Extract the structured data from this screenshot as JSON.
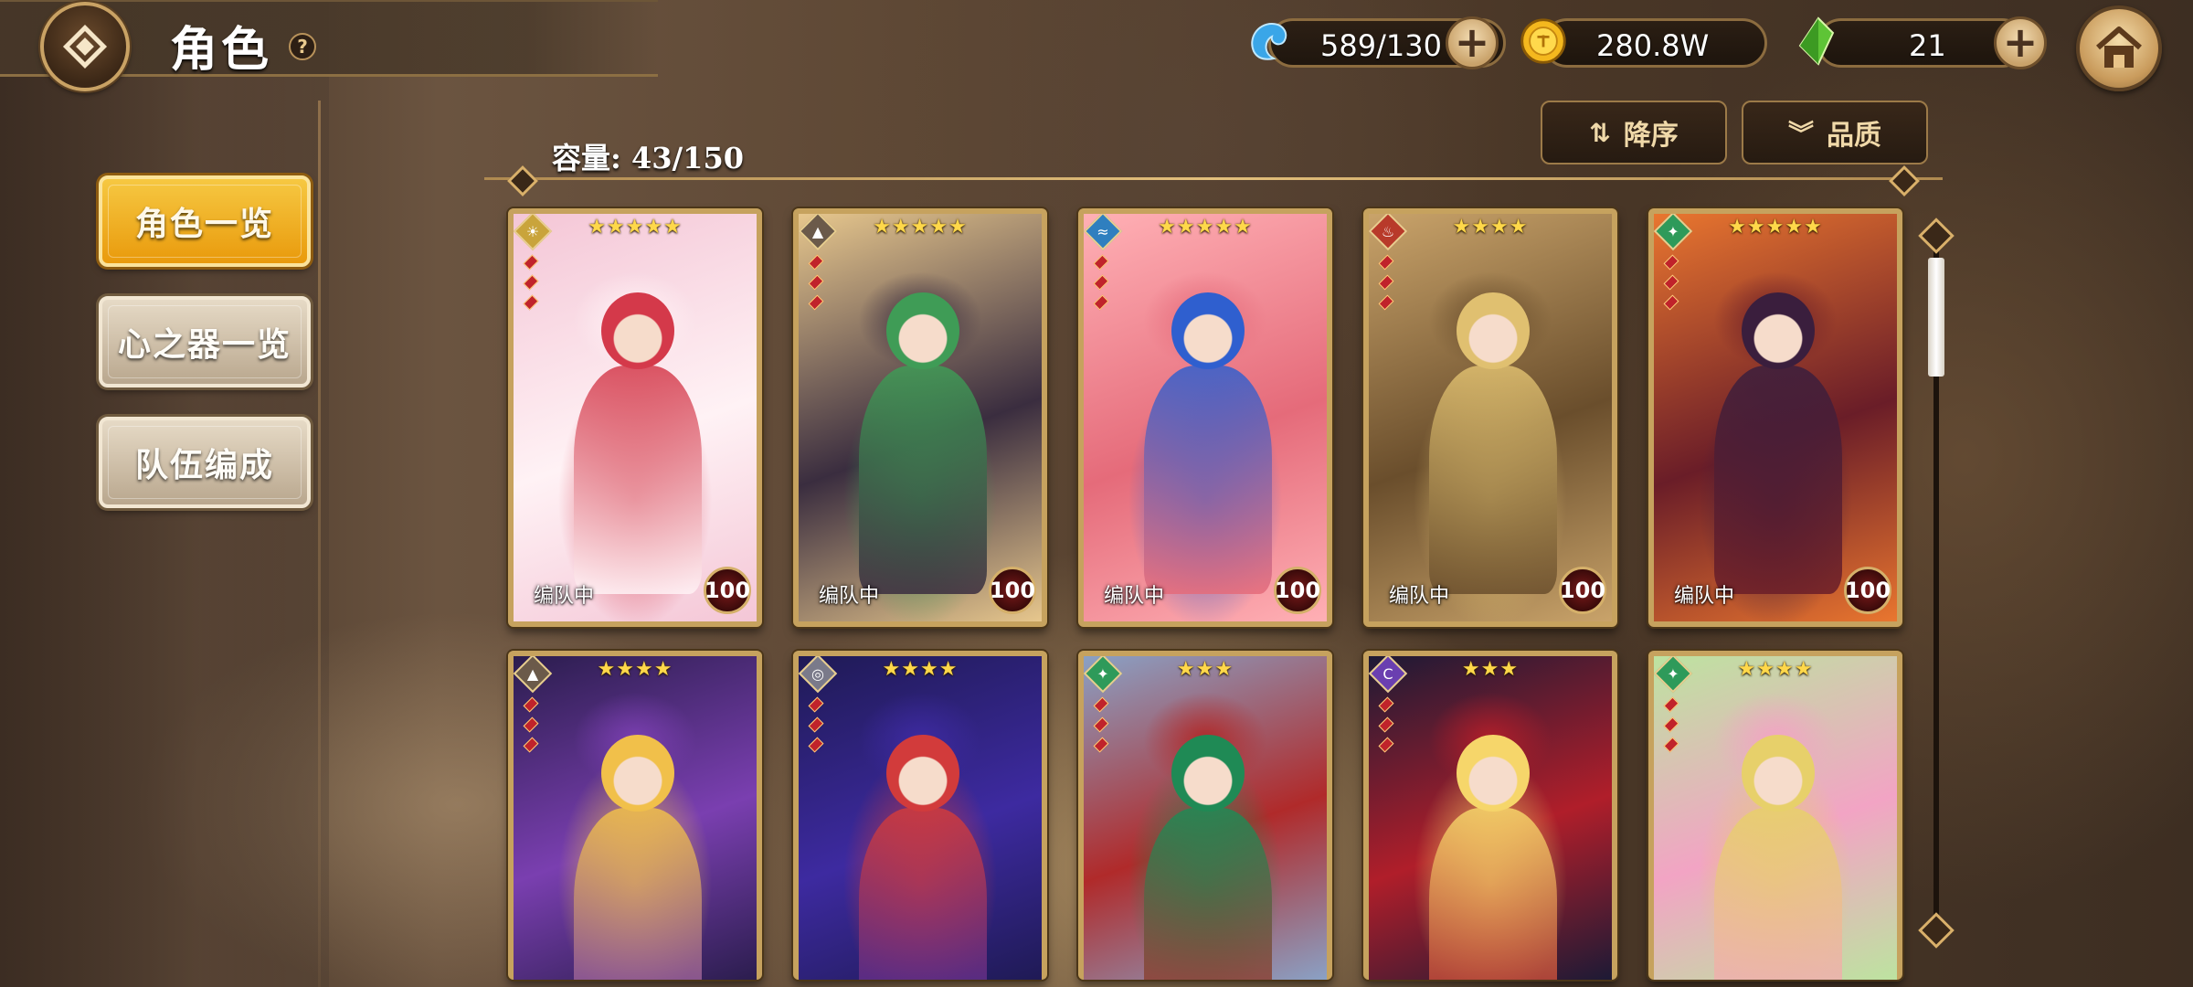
{
  "header": {
    "title": "角色",
    "help": "?"
  },
  "resources": {
    "stamina": "589/130",
    "gold": "280.8W",
    "gems": "21",
    "plus": "+"
  },
  "menu": [
    {
      "label": "角色一览",
      "active": true
    },
    {
      "label": "心之器一览",
      "active": false
    },
    {
      "label": "队伍编成",
      "active": false
    }
  ],
  "capacity": "容量: 43/150",
  "sort": {
    "order_label": "降序",
    "order_icon": "⇅",
    "filter_label": "品质",
    "filter_icon": "︾"
  },
  "cards": [
    {
      "stars": "★★★★★",
      "tag": "编队中",
      "level": "100",
      "element": "☀",
      "elem_color": "#c9a43b",
      "theme": [
        "#f4c6d6",
        "#fff2f5",
        "#d4394a"
      ]
    },
    {
      "stars": "★★★★★",
      "tag": "编队中",
      "level": "100",
      "element": "▲",
      "elem_color": "#6b5a4a",
      "theme": [
        "#e7c78d",
        "#3a2d3f",
        "#3f9c56"
      ]
    },
    {
      "stars": "★★★★★",
      "tag": "编队中",
      "level": "100",
      "element": "≈",
      "elem_color": "#2f7fbf",
      "theme": [
        "#ffb0b5",
        "#e56b7a",
        "#2f5fcf"
      ]
    },
    {
      "stars": "★★★★",
      "tag": "编队中",
      "level": "100",
      "element": "♨",
      "elem_color": "#b83a2a",
      "theme": [
        "#c9a36a",
        "#6a4e2c",
        "#e0c070"
      ]
    },
    {
      "stars": "★★★★★",
      "tag": "编队中",
      "level": "100",
      "element": "✦",
      "elem_color": "#2e9a5a",
      "theme": [
        "#e9762f",
        "#6a1d28",
        "#3a1e3d"
      ]
    },
    {
      "stars": "★★★★",
      "tag": "",
      "level": "",
      "element": "▲",
      "elem_color": "#6b5a4a",
      "theme": [
        "#2b1d4e",
        "#7a3fb0",
        "#f1c04a"
      ]
    },
    {
      "stars": "★★★★",
      "tag": "",
      "level": "",
      "element": "◎",
      "elem_color": "#7a7a8a",
      "theme": [
        "#1f1a55",
        "#3d2aa0",
        "#d23b3b"
      ]
    },
    {
      "stars": "★★★",
      "tag": "",
      "level": "",
      "element": "✦",
      "elem_color": "#2e9a5a",
      "theme": [
        "#8aa1c5",
        "#b02a2a",
        "#1f8a55"
      ]
    },
    {
      "stars": "★★★",
      "tag": "",
      "level": "",
      "element": "C",
      "elem_color": "#6a3fb0",
      "theme": [
        "#1d1a35",
        "#b01e2a",
        "#f6d66a"
      ]
    },
    {
      "stars": "★★★★",
      "tag": "",
      "level": "",
      "element": "✦",
      "elem_color": "#2e9a5a",
      "theme": [
        "#bde3a0",
        "#f2a4c4",
        "#e7d06a"
      ]
    }
  ],
  "icons": {
    "back": "diamond-back-icon",
    "home": "house-icon",
    "stamina": "blue-spirit-icon",
    "gold": "gold-coin-icon",
    "gem": "green-crystal-icon"
  }
}
